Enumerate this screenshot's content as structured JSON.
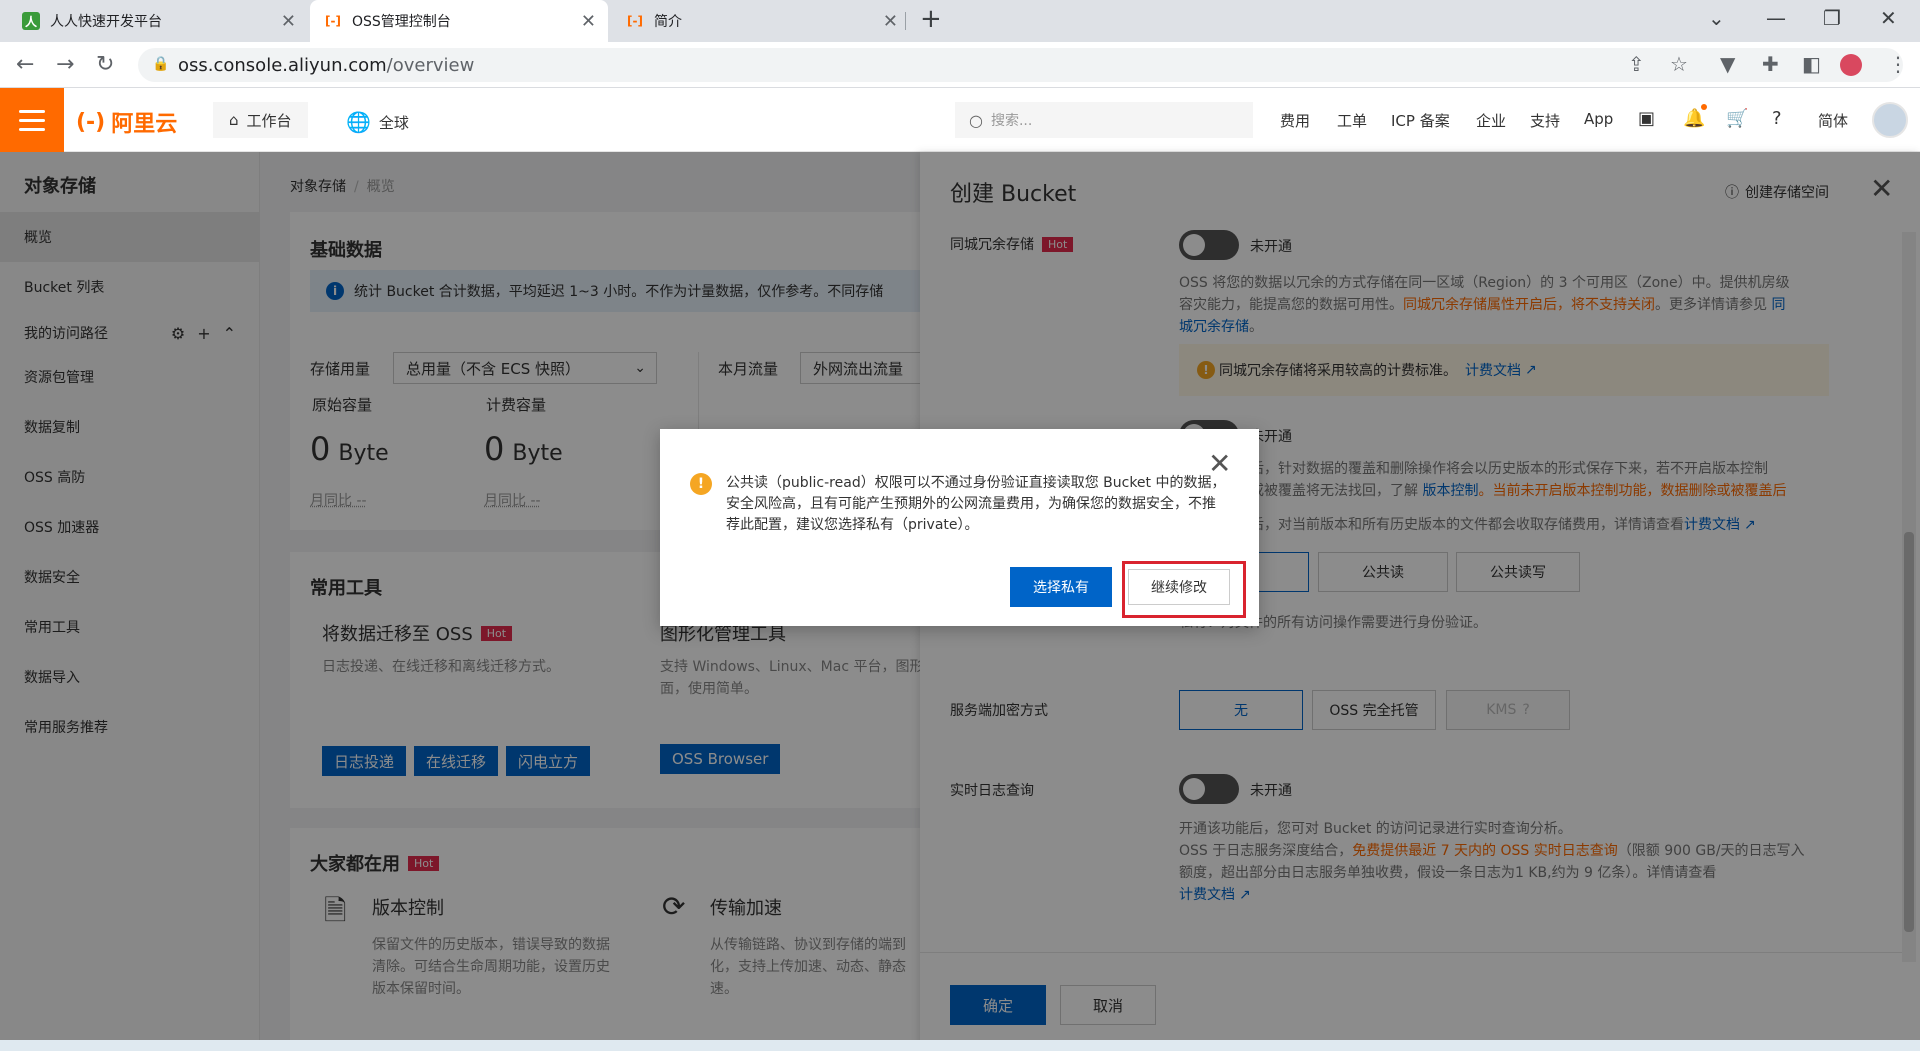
{
  "browser": {
    "tabs": [
      {
        "title": "人人快速开发平台",
        "icon": "green-app-icon"
      },
      {
        "title": "OSS管理控制台",
        "icon": "aliyun-icon"
      },
      {
        "title": "简介",
        "icon": "aliyun-icon"
      }
    ],
    "url_host": "oss.console.aliyun.com",
    "url_path": "/overview"
  },
  "header": {
    "logo": "阿里云",
    "workbench": "工作台",
    "region": "全球",
    "search_placeholder": "搜索...",
    "links": [
      "费用",
      "工单",
      "ICP 备案",
      "企业",
      "支持",
      "App"
    ],
    "language": "简体"
  },
  "sidebar": {
    "title": "对象存储",
    "items": [
      "概览",
      "Bucket 列表",
      "我的访问路径",
      "资源包管理",
      "数据复制",
      "OSS 高防",
      "OSS 加速器",
      "数据安全",
      "常用工具",
      "数据导入",
      "常用服务推荐"
    ]
  },
  "main": {
    "breadcrumb": [
      "对象存储",
      "概览"
    ],
    "basic": {
      "title": "基础数据",
      "info": "统计 Bucket 合计数据，平均延迟 1~3 小时。不作为计量数据，仅作参考。不同存储",
      "storage_label": "存储用量",
      "storage_select": "总用量（不含 ECS 快照）",
      "traffic_label": "本月流量",
      "traffic_select": "外网流出流量",
      "raw_label": "原始容量",
      "billed_label": "计费容量",
      "raw_value": "0",
      "billed_value": "0",
      "unit": "Byte",
      "mom": "月同比  --"
    },
    "tools": {
      "title": "常用工具",
      "migrate_title": "将数据迁移至 OSS",
      "hot": "Hot",
      "migrate_desc": "日志投递、在线迁移和离线迁移方式。",
      "migrate_buttons": [
        "日志投递",
        "在线迁移",
        "闪电立方"
      ],
      "gui_title": "图形化管理工具",
      "gui_desc_1": "支持 Windows、Linux、Mac 平台，图形",
      "gui_desc_2": "面，使用简单。",
      "gui_button": "OSS Browser"
    },
    "popular": {
      "title": "大家都在用",
      "hot": "Hot",
      "version_title": "版本控制",
      "version_desc": [
        "保留文件的历史版本，错误导致的数据",
        "清除。可结合生命周期功能，设置历史",
        "版本保留时间。"
      ],
      "accel_title": "传输加速",
      "accel_desc": [
        "从传输链路、协议到存储的端到",
        "化，支持上传加速、动态、静态",
        "速。"
      ]
    }
  },
  "drawer": {
    "title": "创建 Bucket",
    "help": "创建存储空间",
    "zrs_label": "同城冗余存储",
    "hot": "Hot",
    "off": "未开通",
    "zrs_desc_1": "OSS 将您的数据以冗余的方式存储在同一区域（Region）的 3 个可用区（Zone）中。提供机房级",
    "zrs_desc_2a": "容灾能力，能提高您的数据可用性。",
    "zrs_desc_2b": "同城冗余存储属性开启后，将不支持关闭",
    "zrs_desc_2c": "。更多详情请参见 ",
    "zrs_desc_2d": "同",
    "zrs_desc_3": "城冗余存储",
    "zrs_desc_3b": "。",
    "zrs_warn": "同城冗余存储将采用较高的计费标准。",
    "zrs_warn_link": "计费文档",
    "ver_desc_1": "后，针对数据的覆盖和删除操作将会以历史版本的形式保存下来，若不开启版本控制",
    "ver_desc_2a": "或被覆盖将无法找回，了解 ",
    "ver_desc_2b": "版本控制",
    "ver_desc_2c": "。当前未开启版本控制功能，数据删除或被覆盖后",
    "ver_desc_3a": "后，对当前版本和所有历史版本的文件都会收取存储费用，详情请查看",
    "ver_desc_3b": "计费文档",
    "acl_options": [
      "公共读",
      "公共读写"
    ],
    "acl_desc": "私有：对文件的所有访问操作需要进行身份验证。",
    "enc_label": "服务端加密方式",
    "enc_options": [
      "无",
      "OSS 完全托管",
      "KMS"
    ],
    "log_label": "实时日志查询",
    "log_desc_1": "开通该功能后，您可对 Bucket 的访问记录进行实时查询分析。",
    "log_desc_2a": "OSS 于日志服务深度结合，",
    "log_desc_2b": "免费提供最近 7 天内的 OSS 实时日志查询",
    "log_desc_2c": "（限额 900 GB/天的日志写入",
    "log_desc_3": "额度，超出部分由日志服务单独收费，假设一条日志为1 KB,约为 9 亿条）。详情请查看",
    "log_desc_4": "计费文档",
    "ok": "确定",
    "cancel": "取消"
  },
  "modal": {
    "text": "公共读（public-read）权限可以不通过身份验证直接读取您 Bucket 中的数据，安全风险高，且有可能产生预期外的公网流量费用，为确保您的数据安全，不推荐此配置，建议您选择私有（private）。",
    "private_button": "选择私有",
    "continue_button": "继续修改"
  },
  "colors": {
    "brand": "#ff6a00",
    "primary": "#0064c8",
    "hot": "#e42b4e",
    "highlight": "#d9232e"
  }
}
